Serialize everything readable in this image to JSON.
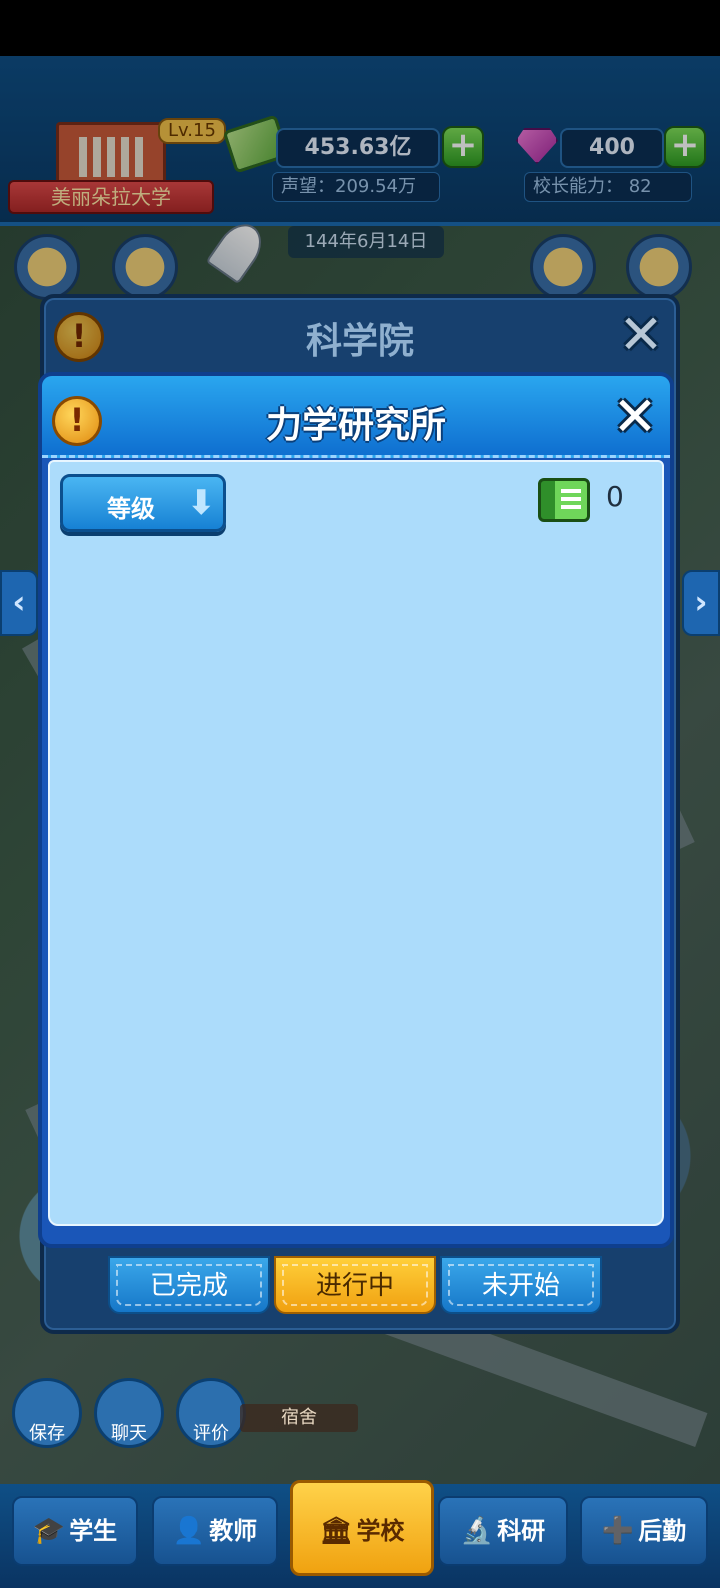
{
  "header": {
    "school_name": "美丽朵拉大学",
    "level": "Lv.15",
    "money": "453.63亿",
    "reputation": "声望：209.54万",
    "gems": "400",
    "principal_ability": "校长能力：  82",
    "date": "144年6月14日"
  },
  "back_panel": {
    "title": "科学院",
    "tabs": [
      {
        "label": "已完成",
        "active": false
      },
      {
        "label": "进行中",
        "active": true
      },
      {
        "label": "未开始",
        "active": false
      }
    ]
  },
  "dialog": {
    "title": "力学研究所",
    "sort_label": "等级",
    "sort_arrow": "⬇",
    "book_count": "0"
  },
  "map": {
    "dorm_label": "宿舍"
  },
  "quick_actions": [
    {
      "label": "保存",
      "icon": "download-icon"
    },
    {
      "label": "聊天",
      "icon": "chat-icon"
    },
    {
      "label": "评价",
      "icon": "edit-icon"
    }
  ],
  "nav": [
    {
      "label": "学生",
      "icon": "graduation-cap-icon",
      "glyph": "🎓",
      "active": false
    },
    {
      "label": "教师",
      "icon": "teacher-icon",
      "glyph": "👤",
      "active": false
    },
    {
      "label": "学校",
      "icon": "school-icon",
      "glyph": "🏛",
      "active": true
    },
    {
      "label": "科研",
      "icon": "microscope-icon",
      "glyph": "🔬",
      "active": false
    },
    {
      "label": "后勤",
      "icon": "logistics-icon",
      "glyph": "➕",
      "active": false
    }
  ],
  "glyphs": {
    "alert": "!",
    "close": "✕",
    "plus": "+",
    "arrow_left": "‹",
    "arrow_right": "›"
  },
  "colors": {
    "accent_blue": "#1677c8",
    "active_yellow": "#f0a010",
    "panel_body": "#acdcfb"
  }
}
